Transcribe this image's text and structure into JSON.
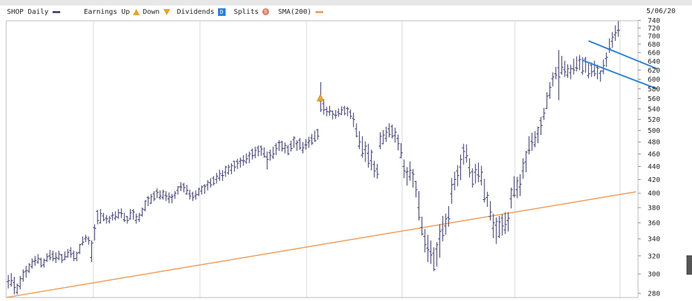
{
  "legend": {
    "symbol_label": "SHOP Daily",
    "earnings_label": "Earnings",
    "up_label": "Up",
    "down_label": "Down",
    "dividends_label": "Dividends",
    "dividends_glyph": "D",
    "splits_label": "Splits",
    "splits_glyph": "S",
    "sma_label": "SMA(200)"
  },
  "date_label": "5/06/20",
  "colors": {
    "price_bars": "#4a4a78",
    "sma": "#f0a060",
    "trendlines": "#2a7fd4",
    "earnings_marker": "#e8a433",
    "grid": "#d8d8d8"
  },
  "chart_data": {
    "type": "ohlc",
    "symbol": "SHOP",
    "interval": "Daily",
    "ylim": [
      280,
      740
    ],
    "y_scale": "log",
    "yticks": [
      280,
      300,
      320,
      340,
      360,
      380,
      400,
      420,
      440,
      460,
      480,
      500,
      520,
      540,
      560,
      580,
      600,
      620,
      640,
      660,
      680,
      700,
      720,
      740
    ],
    "y_axis_side": "right",
    "grid": true,
    "price": {
      "high": [
        299,
        301,
        297,
        290,
        298,
        305,
        309,
        312,
        317,
        320,
        322,
        318,
        317,
        323,
        327,
        326,
        324,
        326,
        322,
        325,
        328,
        330,
        326,
        325,
        334,
        343,
        345,
        343,
        338,
        358,
        377,
        378,
        373,
        370,
        369,
        374,
        375,
        378,
        379,
        373,
        369,
        378,
        378,
        372,
        373,
        380,
        390,
        396,
        399,
        403,
        407,
        404,
        405,
        403,
        401,
        399,
        403,
        410,
        416,
        415,
        412,
        405,
        402,
        404,
        408,
        411,
        413,
        419,
        422,
        425,
        430,
        435,
        434,
        441,
        443,
        445,
        449,
        452,
        454,
        458,
        461,
        464,
        469,
        472,
        474,
        474,
        471,
        464,
        467,
        472,
        478,
        483,
        482,
        479,
        475,
        482,
        490,
        483,
        487,
        480,
        485,
        489,
        494,
        500,
        503,
        594,
        559,
        544,
        546,
        537,
        538,
        541,
        545,
        546,
        544,
        539,
        533,
        513,
        499,
        490,
        481,
        477,
        467,
        449,
        444,
        497,
        501,
        507,
        513,
        511,
        505,
        493,
        478,
        451,
        439,
        448,
        436,
        418,
        403,
        368,
        352,
        345,
        338,
        330,
        336,
        358,
        369,
        372,
        382,
        422,
        432,
        442,
        459,
        477,
        476,
        453,
        437,
        444,
        446,
        441,
        421,
        402,
        389,
        372,
        367,
        369,
        371,
        374,
        374,
        408,
        425,
        424,
        428,
        453,
        465,
        490,
        496,
        499,
        507,
        525,
        542,
        573,
        594,
        615,
        627,
        666,
        652,
        641,
        633,
        632,
        646,
        651,
        654,
        649,
        650,
        637,
        637,
        641,
        632,
        619,
        644,
        660,
        694,
        710,
        727,
        738
      ],
      "low": [
        285,
        287,
        279,
        279,
        284,
        292,
        296,
        301,
        306,
        309,
        311,
        307,
        307,
        313,
        315,
        314,
        312,
        315,
        312,
        315,
        318,
        318,
        314,
        314,
        322,
        332,
        336,
        333,
        313,
        338,
        358,
        359,
        362,
        359,
        359,
        363,
        363,
        365,
        366,
        361,
        359,
        364,
        364,
        359,
        361,
        368,
        375,
        382,
        385,
        389,
        393,
        391,
        391,
        389,
        386,
        386,
        392,
        398,
        403,
        401,
        398,
        391,
        389,
        391,
        396,
        398,
        399,
        404,
        408,
        411,
        414,
        418,
        418,
        424,
        427,
        428,
        432,
        436,
        438,
        441,
        444,
        445,
        451,
        453,
        456,
        457,
        454,
        435,
        449,
        452,
        458,
        465,
        464,
        461,
        458,
        464,
        470,
        465,
        467,
        461,
        467,
        470,
        475,
        480,
        484,
        534,
        529,
        526,
        527,
        520,
        521,
        525,
        528,
        528,
        526,
        521,
        506,
        488,
        468,
        454,
        447,
        438,
        434,
        423,
        421,
        468,
        476,
        480,
        488,
        486,
        479,
        466,
        453,
        422,
        411,
        418,
        408,
        394,
        363,
        344,
        324,
        313,
        311,
        303,
        308,
        318,
        337,
        345,
        355,
        385,
        404,
        410,
        419,
        443,
        446,
        423,
        408,
        414,
        416,
        411,
        387,
        381,
        363,
        341,
        334,
        341,
        344,
        346,
        349,
        379,
        394,
        393,
        396,
        421,
        431,
        459,
        465,
        471,
        478,
        492,
        519,
        540,
        560,
        585,
        600,
        557,
        610,
        605,
        603,
        600,
        610,
        617,
        620,
        610,
        614,
        602,
        605,
        606,
        600,
        595,
        611,
        627,
        659,
        671,
        688,
        698
      ],
      "open": [
        292,
        289,
        291,
        281,
        287,
        295,
        303,
        303,
        308,
        314,
        313,
        316,
        310,
        315,
        320,
        322,
        317,
        317,
        321,
        316,
        319,
        326,
        323,
        317,
        324,
        334,
        340,
        340,
        318,
        354,
        375,
        360,
        369,
        366,
        362,
        369,
        366,
        367,
        373,
        364,
        368,
        365,
        376,
        363,
        364,
        370,
        377,
        394,
        386,
        399,
        403,
        394,
        394,
        397,
        392,
        394,
        397,
        404,
        409,
        412,
        399,
        399,
        399,
        396,
        398,
        403,
        411,
        412,
        415,
        422,
        420,
        422,
        426,
        431,
        430,
        434,
        448,
        448,
        448,
        449,
        447,
        457,
        466,
        458,
        470,
        472,
        460,
        455,
        462,
        455,
        474,
        479,
        480,
        469,
        471,
        476,
        484,
        477,
        483,
        466,
        475,
        479,
        487,
        486,
        501,
        555,
        550,
        539,
        534,
        535,
        528,
        534,
        530,
        542,
        541,
        534,
        522,
        503,
        473,
        458,
        467,
        461,
        449,
        443,
        436,
        473,
        477,
        486,
        503,
        507,
        491,
        486,
        454,
        440,
        431,
        424,
        430,
        417,
        380,
        354,
        343,
        329,
        325,
        323,
        328,
        340,
        351,
        356,
        367,
        399,
        413,
        433,
        439,
        470,
        454,
        438,
        432,
        431,
        427,
        418,
        391,
        394,
        368,
        353,
        357,
        343,
        366,
        351,
        363,
        392,
        397,
        405,
        409,
        433,
        447,
        466,
        481,
        475,
        494,
        518,
        525,
        541,
        567,
        601,
        612,
        625,
        614,
        621,
        609,
        614,
        623,
        625,
        642,
        615,
        645,
        608,
        631,
        618,
        626,
        613,
        618,
        646,
        667,
        687,
        703,
        714
      ],
      "close": [
        293,
        293,
        286,
        288,
        295,
        302,
        304,
        310,
        314,
        315,
        317,
        309,
        315,
        319,
        318,
        317,
        318,
        322,
        315,
        319,
        324,
        322,
        317,
        323,
        333,
        336,
        342,
        338,
        335,
        353,
        363,
        372,
        364,
        365,
        366,
        370,
        368,
        373,
        372,
        363,
        363,
        373,
        374,
        368,
        370,
        378,
        389,
        393,
        395,
        392,
        401,
        396,
        402,
        396,
        395,
        395,
        400,
        409,
        409,
        408,
        404,
        396,
        394,
        398,
        406,
        409,
        410,
        416,
        412,
        414,
        425,
        429,
        426,
        439,
        439,
        441,
        439,
        445,
        450,
        449,
        452,
        460,
        457,
        466,
        464,
        468,
        456,
        451,
        458,
        460,
        469,
        479,
        469,
        474,
        460,
        469,
        487,
        479,
        470,
        470,
        475,
        482,
        478,
        482,
        490,
        538,
        538,
        535,
        536,
        530,
        528,
        531,
        538,
        531,
        540,
        526,
        520,
        490,
        480,
        461,
        473,
        445,
        463,
        433,
        428,
        490,
        492,
        497,
        493,
        490,
        497,
        477,
        462,
        433,
        432,
        434,
        428,
        405,
        367,
        346,
        333,
        327,
        321,
        305,
        333,
        349,
        344,
        365,
        365,
        412,
        420,
        426,
        451,
        464,
        457,
        430,
        413,
        435,
        425,
        431,
        392,
        397,
        374,
        360,
        362,
        361,
        356,
        358,
        366,
        405,
        397,
        418,
        413,
        445,
        463,
        466,
        479,
        488,
        505,
        509,
        532,
        565,
        583,
        605,
        609,
        605,
        626,
        616,
        623,
        623,
        620,
        624,
        644,
        618,
        638,
        612,
        616,
        612,
        624,
        618,
        630,
        649,
        670,
        697,
        708,
        714
      ]
    },
    "sma_200": {
      "start": 276,
      "end": 402
    },
    "earnings": [
      {
        "direction": "up",
        "bar_index": 105,
        "value": 562
      }
    ],
    "trendlines": [
      {
        "from": {
          "bar": 195,
          "value": 688
        },
        "to": {
          "bar": 218,
          "value": 623
        }
      },
      {
        "from": {
          "bar": 193,
          "value": 642
        },
        "to": {
          "bar": 218,
          "value": 580
        }
      }
    ],
    "date_label": "5/06/20"
  }
}
